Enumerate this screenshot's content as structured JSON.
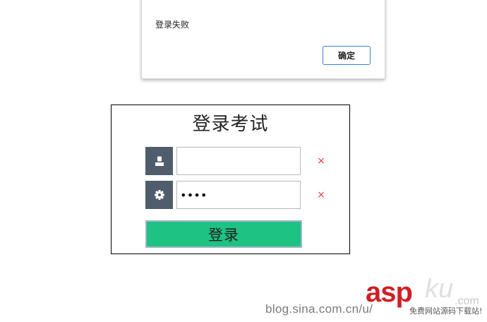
{
  "alert": {
    "message": "登录失败",
    "ok_label": "确定"
  },
  "login": {
    "title": "登录考试",
    "username": {
      "value": "",
      "icon": "user-icon",
      "error_mark": "×"
    },
    "password": {
      "value": "1234",
      "icon": "gear-icon",
      "error_mark": "×"
    },
    "submit_label": "登录"
  },
  "watermark": {
    "blog_text": "blog.sina.com.cn/u/",
    "brand_asp": "asp",
    "brand_ku": "ku",
    "brand_com": ".com",
    "slogan": "免费网站源码下载站!"
  },
  "colors": {
    "icon_bg": "#4f5d6c",
    "button_bg": "#1ec283",
    "error": "#e63946",
    "brand_red": "#d01f24",
    "dialog_button_border": "#3b7fd1"
  }
}
